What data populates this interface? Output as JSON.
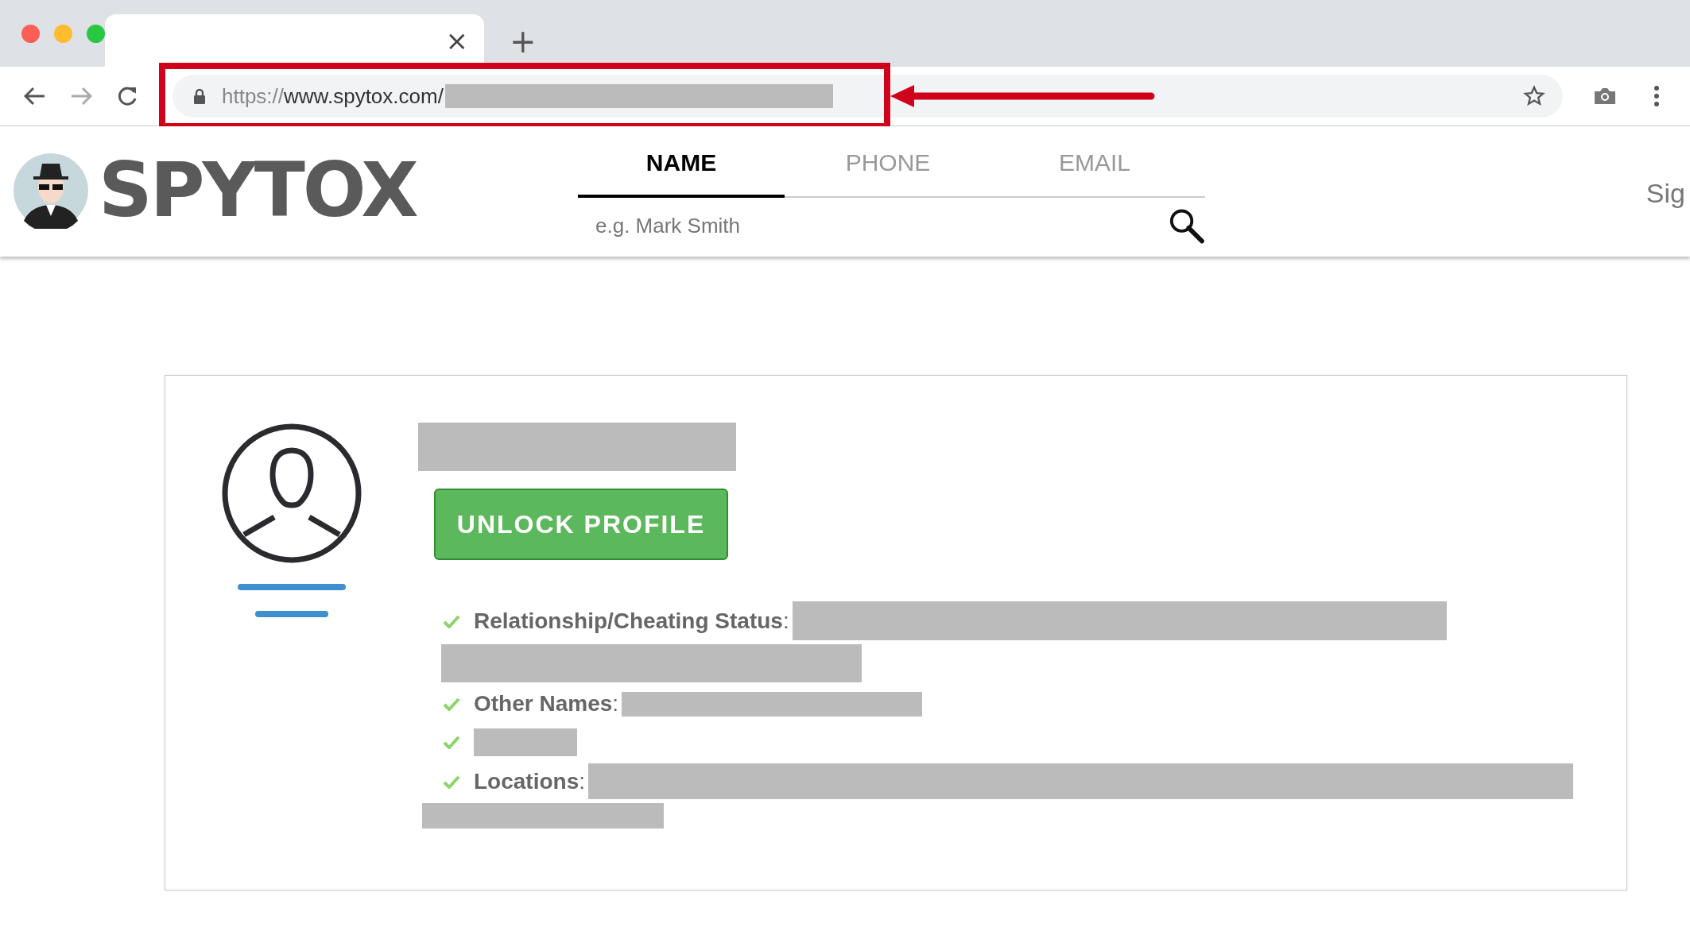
{
  "browser": {
    "tab_close": "×",
    "new_tab": "+",
    "url": "https://www.spytox.com/"
  },
  "site": {
    "logo": "SPYTOX",
    "search_tabs": [
      {
        "label": "NAME",
        "selected": true
      },
      {
        "label": "PHONE",
        "selected": false
      },
      {
        "label": "EMAIL",
        "selected": false
      }
    ],
    "search": {
      "placeholder": "e.g. Mark Smith"
    },
    "sign_in": "Sig"
  },
  "profile": {
    "button": "UNLOCK PROFILE",
    "details": [
      {
        "kind": "labeled",
        "label": "**Relationship/Cheating Status**:"
      },
      {
        "kind": "labeled",
        "label": "**Other Names**:"
      },
      {
        "kind": "redacted"
      },
      {
        "kind": "labeled",
        "label": "**Locations**:"
      }
    ]
  }
}
